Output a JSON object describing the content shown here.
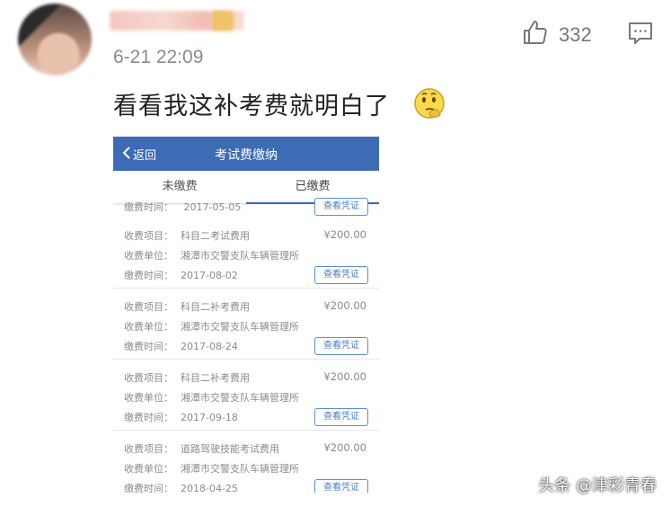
{
  "comment": {
    "timestamp": "6-21 22:09",
    "likes": "332",
    "text": "看看我这补考费就明白了"
  },
  "phone": {
    "back_label": "返回",
    "title": "考试费缴纳",
    "tabs": [
      {
        "label": "未缴费",
        "active": false
      },
      {
        "label": "已缴费",
        "active": true
      }
    ],
    "field_labels": {
      "item": "收费项目：",
      "unit": "收费单位：",
      "time": "缴费时间："
    },
    "top_partial": {
      "time": "2017-05-05",
      "button": "查看凭证"
    },
    "records": [
      {
        "item": "科目二考试费用",
        "amount": "¥200.00",
        "unit": "湘潭市交警支队车辆管理所",
        "time": "2017-08-02",
        "button": "查看凭证"
      },
      {
        "item": "科目二补考费用",
        "amount": "¥200.00",
        "unit": "湘潭市交警支队车辆管理所",
        "time": "2017-08-24",
        "button": "查看凭证"
      },
      {
        "item": "科目二补考费用",
        "amount": "¥200.00",
        "unit": "湘潭市交警支队车辆管理所",
        "time": "2017-09-18",
        "button": "查看凭证"
      },
      {
        "item": "道路驾驶技能考试费用",
        "amount": "¥200.00",
        "unit": "湘潭市交警支队车辆管理所",
        "time": "2018-04-25",
        "button": "查看凭证"
      }
    ]
  },
  "watermark": "头条 @津彩青春",
  "icons": {
    "like": "thumbs-up-icon",
    "comment": "comment-icon",
    "emoji": "thinking-face-icon",
    "back": "chevron-left-icon"
  }
}
